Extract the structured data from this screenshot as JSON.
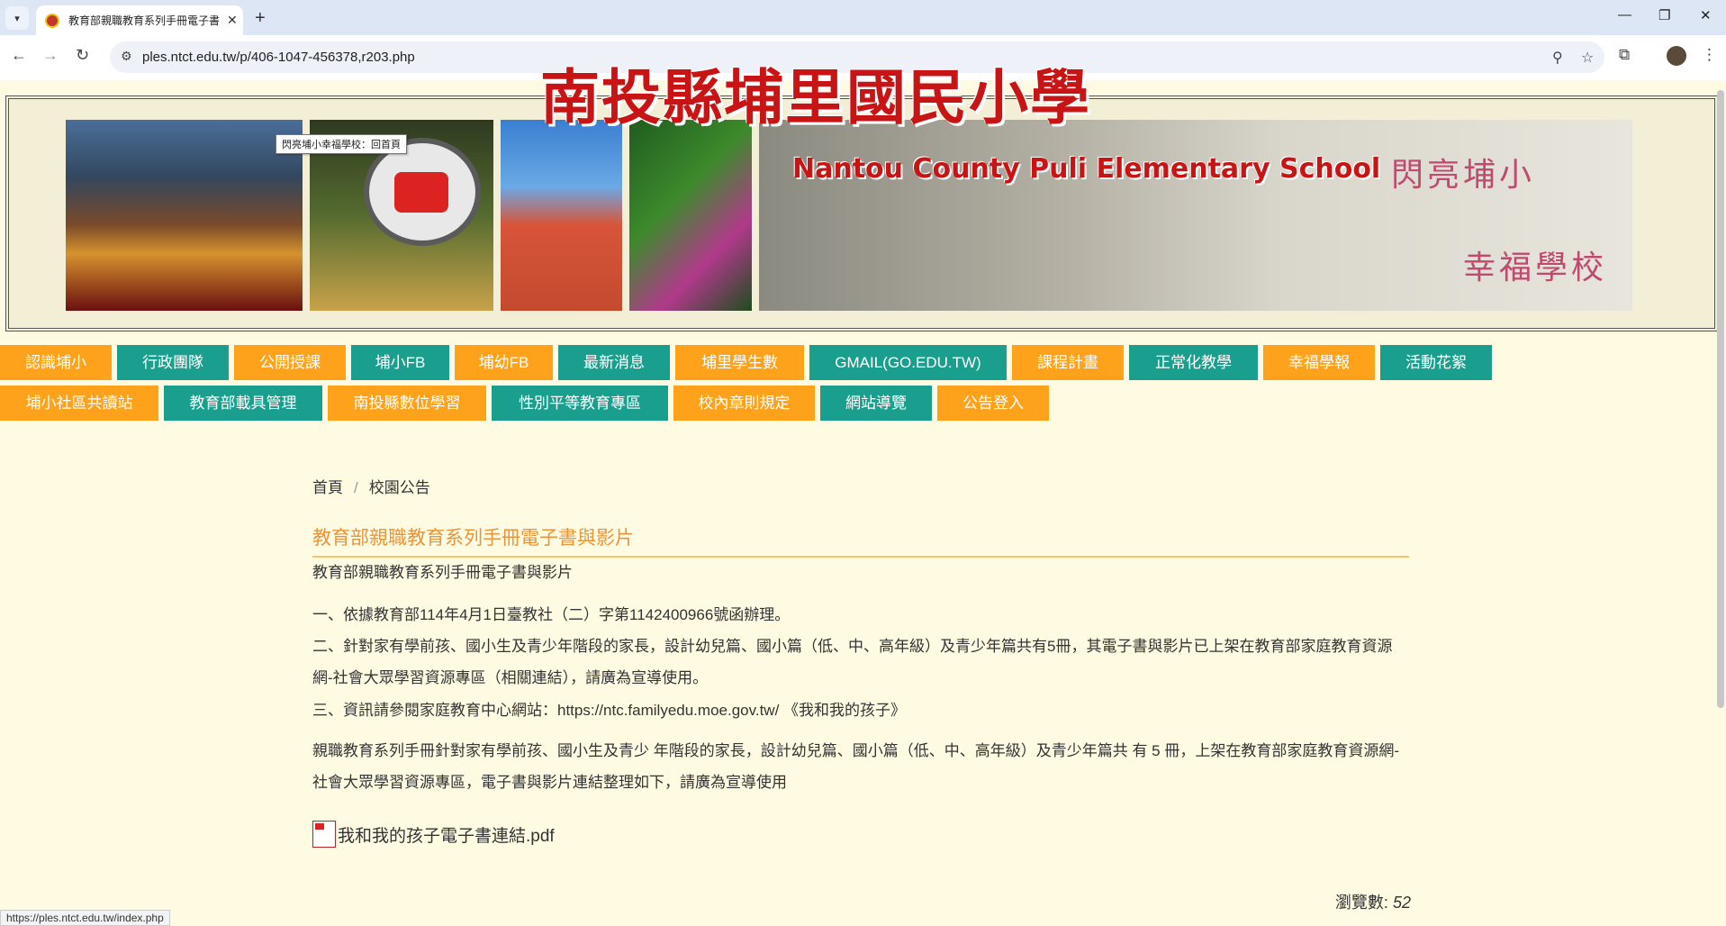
{
  "browser": {
    "tab_title": "教育部親職教育系列手冊電子書",
    "url": "ples.ntct.edu.tw/p/406-1047-456378,r203.php",
    "status_url": "https://ples.ntct.edu.tw/index.php"
  },
  "banner": {
    "tooltip": "閃亮埔小幸福學校：回首頁",
    "school_zh": "南投縣埔里國民小學",
    "school_en": "Nantou County Puli Elementary School",
    "motto_1": "閃亮埔小",
    "motto_2": "幸福學校"
  },
  "menu": [
    {
      "label": "認識埔小",
      "color": "#ffa21b",
      "w": 124
    },
    {
      "label": "行政團隊",
      "color": "#1a9f8f",
      "w": 124
    },
    {
      "label": "公開授課",
      "color": "#ffa21b",
      "w": 124
    },
    {
      "label": "埔小FB",
      "color": "#1a9f8f",
      "w": 109
    },
    {
      "label": "埔幼FB",
      "color": "#ffa21b",
      "w": 109
    },
    {
      "label": "最新消息",
      "color": "#1a9f8f",
      "w": 124
    },
    {
      "label": "埔里學生數",
      "color": "#ffa21b",
      "w": 143
    },
    {
      "label": "GMAIL(GO.EDU.TW)",
      "color": "#1a9f8f",
      "w": 219
    },
    {
      "label": "課程計畫",
      "color": "#ffa21b",
      "w": 124
    },
    {
      "label": "正常化教學",
      "color": "#1a9f8f",
      "w": 143
    },
    {
      "label": "幸福學報",
      "color": "#ffa21b",
      "w": 124
    },
    {
      "label": "活動花絮",
      "color": "#1a9f8f",
      "w": 124
    },
    {
      "label": "埔小社區共讀站",
      "color": "#ffa21b",
      "w": 176
    },
    {
      "label": "教育部載具管理",
      "color": "#1a9f8f",
      "w": 176
    },
    {
      "label": "南投縣數位學習",
      "color": "#ffa21b",
      "w": 176
    },
    {
      "label": "性別平等教育專區",
      "color": "#1a9f8f",
      "w": 196
    },
    {
      "label": "校內章則規定",
      "color": "#ffa21b",
      "w": 157
    },
    {
      "label": "網站導覽",
      "color": "#1a9f8f",
      "w": 124
    },
    {
      "label": "公告登入",
      "color": "#ffa21b",
      "w": 124
    }
  ],
  "breadcrumb": {
    "home": "首頁",
    "separator": "/",
    "current": "校園公告"
  },
  "article": {
    "title": "教育部親職教育系列手冊電子書與影片",
    "subtitle": "教育部親職教育系列手冊電子書與影片",
    "item_1": "一、依據教育部114年4月1日臺教社（二）字第1142400966號函辦理。",
    "item_2": "二、針對家有學前孩、國小生及青少年階段的家長，設計幼兒篇、國小篇（低、中、高年級）及青少年篇共有5冊，其電子書與影片已上架在教育部家庭教育資源網-社會大眾學習資源專區（相關連結），請廣為宣導使用。",
    "item_3": "三、資訊請參閱家庭教育中心網站：https://ntc.familyedu.moe.gov.tw/ 《我和我的孩子》",
    "summary": "親職教育系列手冊針對家有學前孩、國小生及青少 年階段的家長，設計幼兒篇、國小篇（低、中、高年級）及青少年篇共 有 5 冊，上架在教育部家庭教育資源網-社會大眾學習資源專區，電子書與影片連結整理如下，請廣為宣導使用",
    "attachment": "我和我的孩子電子書連結.pdf",
    "views_label": "瀏覽數:",
    "views_count": "52"
  }
}
